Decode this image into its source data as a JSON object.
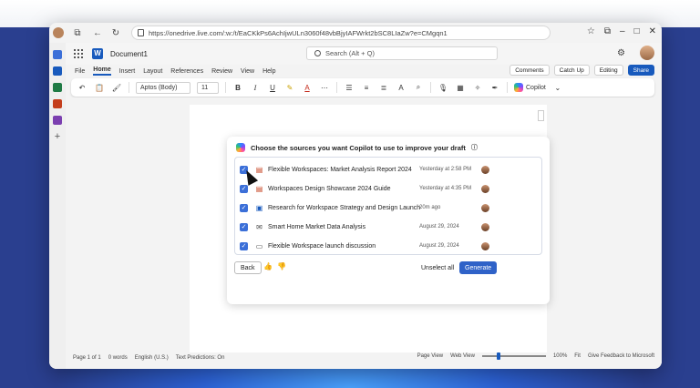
{
  "browser": {
    "url": "https://onedrive.live.com/:w:/t/EaCKkPs6AchIjwULn3060f48vbBjyIAFWrkt2bSC8LIaZw?e=CMgqn1"
  },
  "app": {
    "document_title": "Document1",
    "search_placeholder": "Search (Alt + Q)",
    "brand_color": "#185abd"
  },
  "ribbon": {
    "tabs": [
      "File",
      "Home",
      "Insert",
      "Layout",
      "References",
      "Review",
      "View",
      "Help"
    ],
    "active_tab": "Home",
    "comments_label": "Comments",
    "catchup_label": "Catch Up",
    "editing_label": "Editing",
    "share_label": "Share",
    "font_name": "Aptos (Body)",
    "font_size": "11",
    "bold": "B",
    "italic": "I",
    "underline": "U",
    "copilot_label": "Copilot"
  },
  "copilot_panel": {
    "heading": "Choose the sources you want Copilot to use to improve your draft",
    "sources": [
      {
        "name": "Flexible Workspaces: Market Analysis Report 2024",
        "time": "Yesterday at 2:58 PM",
        "icon": "pdf-icon",
        "checked": true
      },
      {
        "name": "Workspaces Design Showcase 2024 Guide",
        "time": "Yesterday at 4:35 PM",
        "icon": "pdf-icon",
        "checked": true
      },
      {
        "name": "Research for Workspace Strategy and Design Launch",
        "time": "20m ago",
        "icon": "word-file-icon",
        "checked": true
      },
      {
        "name": "Smart Home Market Data Analysis",
        "time": "August 29, 2024",
        "icon": "mail-icon",
        "checked": true
      },
      {
        "name": "Flexible Workspace launch discussion",
        "time": "August 29, 2024",
        "icon": "chat-icon",
        "checked": true
      }
    ],
    "back_label": "Back",
    "unselect_label": "Unselect all",
    "generate_label": "Generate",
    "accent_color": "#2f62c8"
  },
  "status_bar": {
    "page": "Page 1 of 1",
    "words": "0 words",
    "language": "English (U.S.)",
    "predictions": "Text Predictions: On",
    "page_view": "Page View",
    "web_view": "Web View",
    "zoom": "100%",
    "fit": "Fit",
    "feedback": "Give Feedback to Microsoft"
  }
}
